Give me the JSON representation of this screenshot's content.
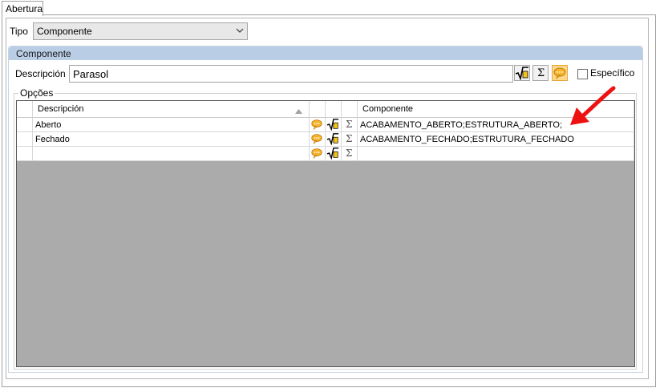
{
  "tab": {
    "label": "Abertura"
  },
  "tipo": {
    "label": "Tipo",
    "value": "Componente"
  },
  "group": {
    "title": "Componente"
  },
  "descripcion": {
    "label": "Descripción",
    "value": "Parasol"
  },
  "especifico": {
    "label": "Específico",
    "checked": false
  },
  "options": {
    "legend": "Opções",
    "columns": [
      "Descripción",
      "Componente"
    ],
    "rows": [
      {
        "descripcion": "Aberto",
        "componente": "ACABAMENTO_ABERTO;ESTRUTURA_ABERTO;"
      },
      {
        "descripcion": "Fechado",
        "componente": "ACABAMENTO_FECHADO;ESTRUTURA_FECHADO"
      },
      {
        "descripcion": "",
        "componente": ""
      }
    ]
  },
  "icons": {
    "comment": "speech-bubble-icon",
    "formula": "square-root-icon",
    "sum": "sigma-icon"
  },
  "colors": {
    "group_header": "#b9cde5",
    "grid_empty": "#ababab",
    "annotation_arrow": "#ee1111"
  }
}
